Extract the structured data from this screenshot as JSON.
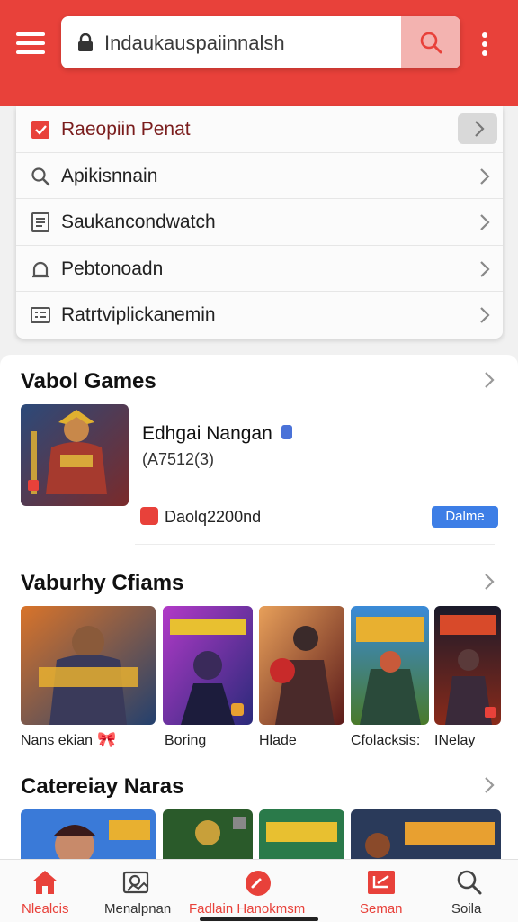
{
  "search": {
    "value": "Indaukauspaiinnalsh"
  },
  "dropdown": {
    "items": [
      {
        "label": "Raeopiin Penat",
        "icon": "checkbox-icon",
        "active": true
      },
      {
        "label": "Apikisnnain",
        "icon": "search-icon"
      },
      {
        "label": "Saukancondwatch",
        "icon": "document-icon"
      },
      {
        "label": "Pebtonoadn",
        "icon": "bell-icon"
      },
      {
        "label": "Ratrtviplickanemin",
        "icon": "list-icon"
      }
    ]
  },
  "section1": {
    "title": "Vabol Games",
    "featured": {
      "name": "Edhgai Nangan",
      "sub": "(A7512(3)",
      "meta": "Daolq2200nd",
      "button": "Dalme"
    }
  },
  "section2": {
    "title": "Vaburhy Cfiams",
    "items": [
      {
        "caption": "Nans ekian"
      },
      {
        "caption": "Boring"
      },
      {
        "caption": "Hlade"
      },
      {
        "caption": "Cfolacksis:"
      },
      {
        "caption": "INelay"
      }
    ]
  },
  "section3": {
    "title": "Catereiay Naras"
  },
  "nav": {
    "items": [
      {
        "label": "Nlealcis",
        "icon": "home-icon"
      },
      {
        "label": "Menalpnan",
        "icon": "gallery-icon"
      },
      {
        "label": "Fadlain Hanokmsm",
        "icon": "gauge-icon"
      },
      {
        "label": "Seman",
        "icon": "chart-icon"
      },
      {
        "label": "Soila",
        "icon": "search-icon"
      }
    ]
  },
  "colors": {
    "accent": "#e8413a",
    "button_blue": "#3d7ee6"
  }
}
